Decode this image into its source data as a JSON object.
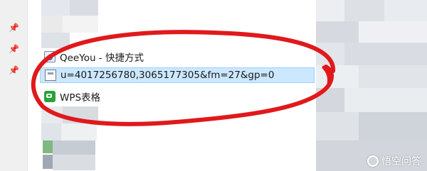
{
  "list_items": [
    {
      "icon": "app-shortcut-icon",
      "label": "QeeYou - 快捷方式",
      "selected": false
    },
    {
      "icon": "image-file-icon",
      "label": "u=4017256780,3065177305&fm=27&gp=0",
      "selected": true
    },
    {
      "icon": "wps-spreadsheet-icon",
      "label": "WPS表格",
      "selected": false
    }
  ],
  "watermark": {
    "label": "悟空问答"
  },
  "colors": {
    "selection": "#cce8ff",
    "selection_border": "#99d1ff",
    "annotation": "#e0191c",
    "wps": "#29a338"
  }
}
